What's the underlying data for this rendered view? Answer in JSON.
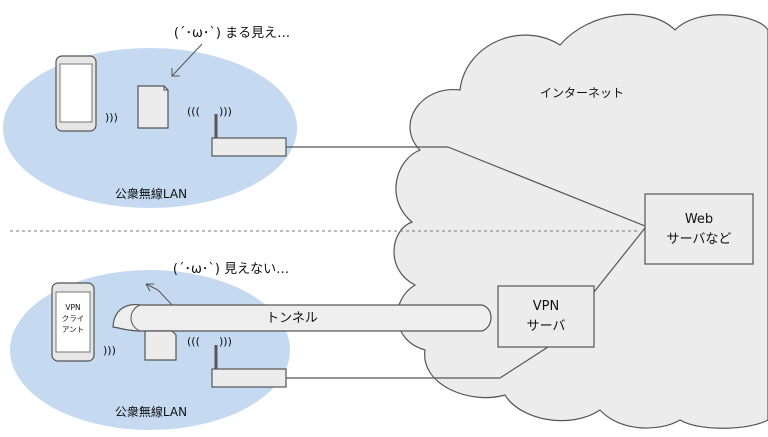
{
  "top": {
    "network_label": "公衆無線LAN",
    "peek_caption": "(´･ω･`) まる見え…"
  },
  "internet": {
    "label": "インターネット",
    "web_server": {
      "line1": "Web",
      "line2": "サーバなど"
    },
    "vpn_server": {
      "line1": "VPN",
      "line2": "サーバ"
    }
  },
  "bottom": {
    "network_label": "公衆無線LAN",
    "blocked_caption": "(´･ω･`) 見えない…",
    "tunnel_label": "トンネル",
    "vpn_client": {
      "line1": "VPN",
      "line2": "クライ",
      "line3": "アント"
    }
  },
  "icons": {
    "wifi_signal": ")))",
    "wifi_signal_left": "(((",
    "wifi_signal_right": ")))"
  },
  "colors": {
    "lan_fill": "#c5daf0",
    "cloud_fill": "#ececec",
    "cloud_stroke": "#555555",
    "tunnel_fill": "#eeeeee"
  }
}
